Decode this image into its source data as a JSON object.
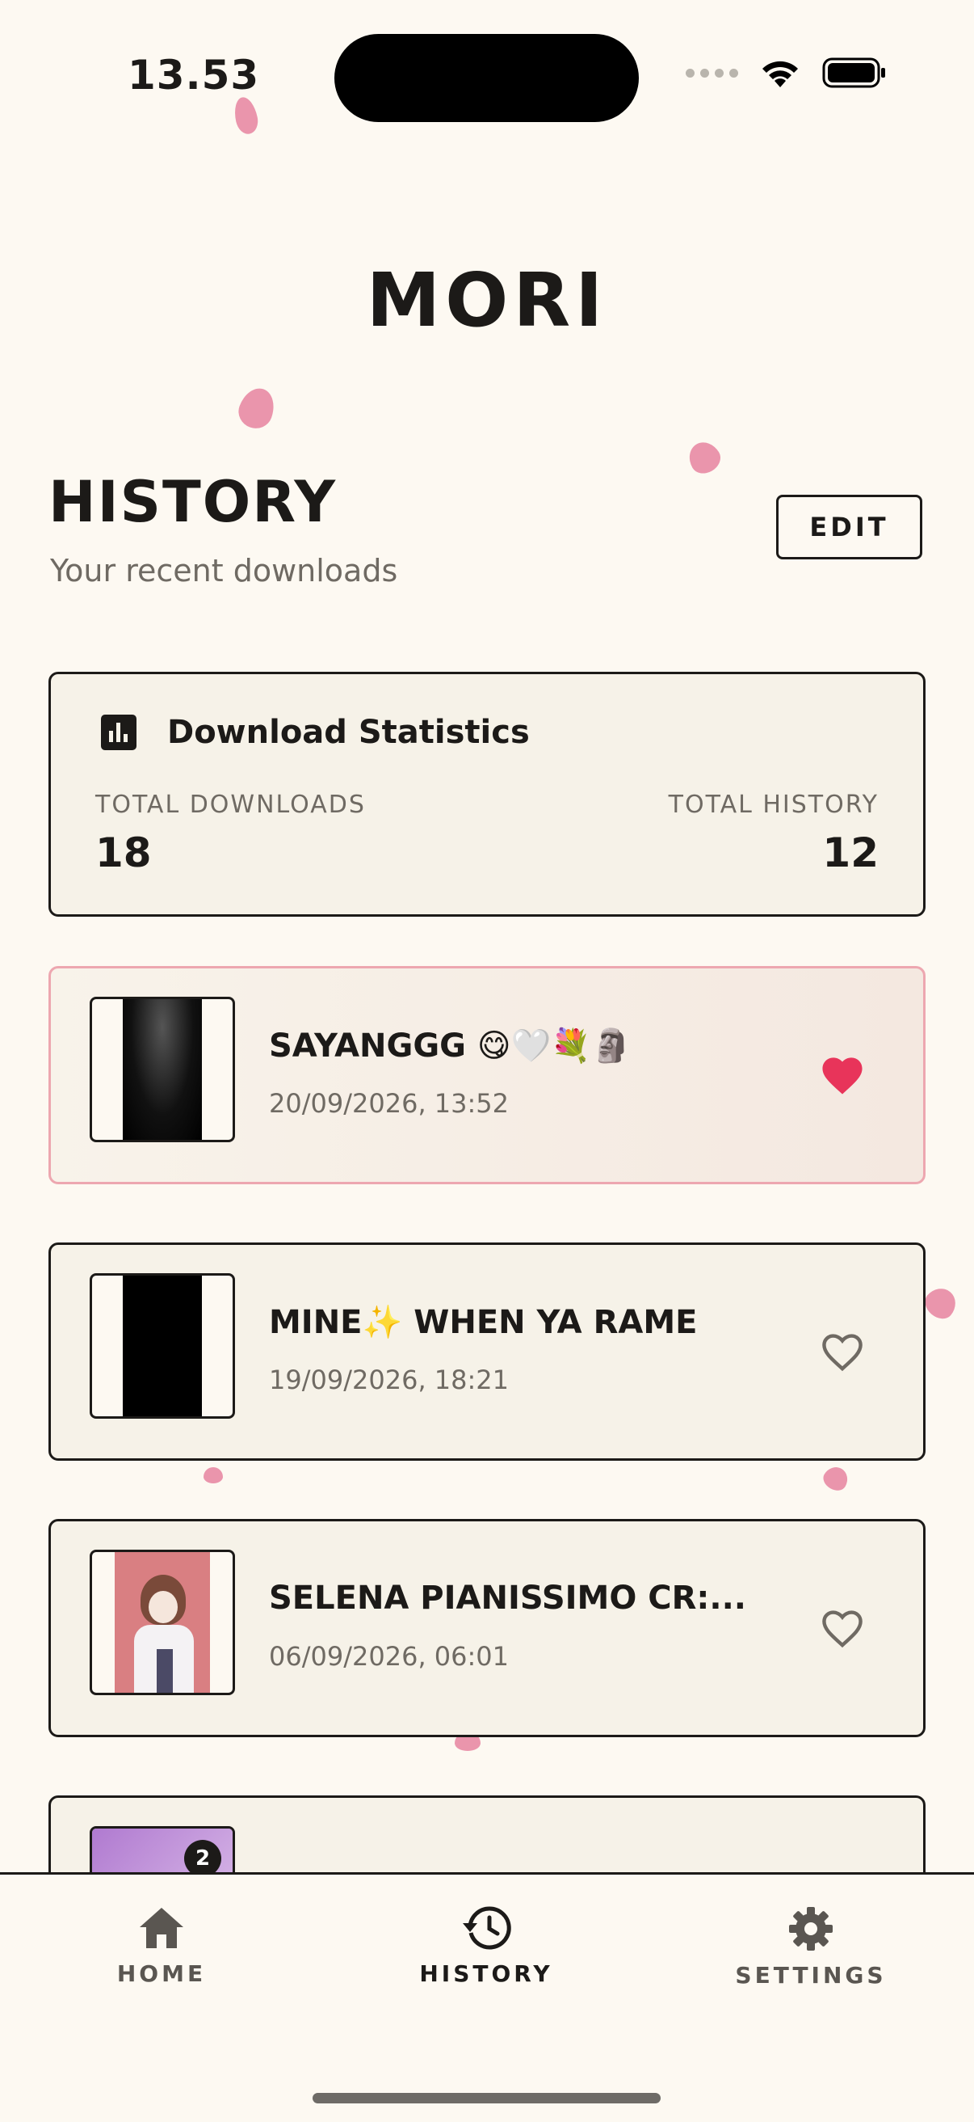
{
  "status_bar": {
    "time": "13.53"
  },
  "app": {
    "title": "MORI"
  },
  "history": {
    "title": "HISTORY",
    "subtitle": "Your recent downloads",
    "edit_label": "EDIT"
  },
  "stats": {
    "title": "Download Statistics",
    "total_downloads_label": "TOTAL DOWNLOADS",
    "total_downloads": "18",
    "total_history_label": "TOTAL HISTORY",
    "total_history": "12"
  },
  "items": [
    {
      "title": "SAYANGGG 😋🤍💐🗿",
      "date": "20/09/2026, 13:52",
      "favorite": true
    },
    {
      "title": "MINE✨ WHEN YA RAME",
      "date": "19/09/2026, 18:21",
      "favorite": false
    },
    {
      "title": "SELENA PIANISSIMO CR:...",
      "date": "06/09/2026, 06:01",
      "favorite": false
    },
    {
      "title": "",
      "date": "",
      "badge": "2",
      "favorite": false
    }
  ],
  "nav": {
    "home": "HOME",
    "history": "HISTORY",
    "settings": "SETTINGS"
  },
  "colors": {
    "accent": "#e8345a",
    "petal": "#e88aa4",
    "background": "#fdf9f2",
    "card": "#f6f2e8",
    "ink": "#1c1a18"
  }
}
